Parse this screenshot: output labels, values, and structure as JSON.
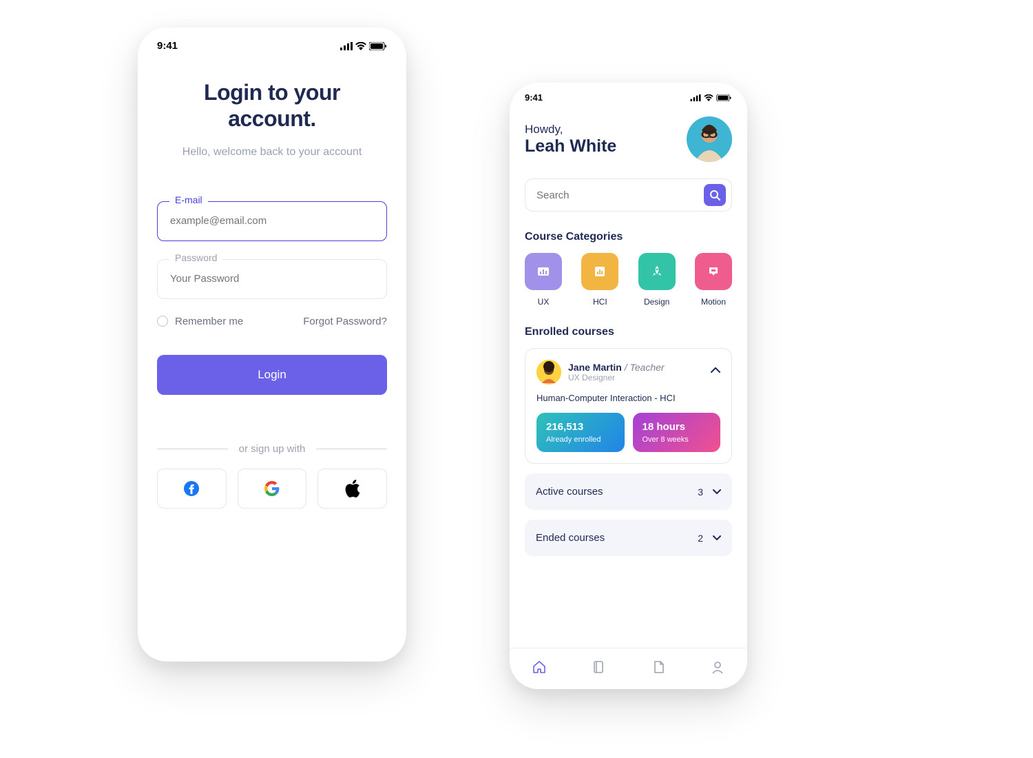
{
  "status_bar": {
    "time": "9:41"
  },
  "login": {
    "title_line1": "Login to your",
    "title_line2": "account.",
    "subtitle": "Hello, welcome back to your account",
    "email_label": "E-mail",
    "email_placeholder": "example@email.com",
    "password_label": "Password",
    "password_placeholder": "Your Password",
    "remember": "Remember me",
    "forgot": "Forgot Password?",
    "login_btn": "Login",
    "divider": "or sign up with"
  },
  "home": {
    "greeting": "Howdy,",
    "name": "Leah White",
    "search_placeholder": "Search",
    "categories_title": "Course Categories",
    "categories": [
      {
        "label": "UX",
        "color": "#a191e8"
      },
      {
        "label": "HCI",
        "color": "#f2b541"
      },
      {
        "label": "Design",
        "color": "#33c4a8"
      },
      {
        "label": "Motion",
        "color": "#ef5d8e"
      }
    ],
    "enrolled_title": "Enrolled courses",
    "teacher": {
      "name": "Jane Martin",
      "role_prefix": " / ",
      "role": "Teacher",
      "sub": "UX Designer"
    },
    "course": "Human-Computer Interaction - HCI",
    "stat1_big": "216,513",
    "stat1_small": "Already enrolled",
    "stat2_big": "18 hours",
    "stat2_small": "Over 8 weeks",
    "active_title": "Active courses",
    "active_count": "3",
    "ended_title": "Ended courses",
    "ended_count": "2"
  }
}
